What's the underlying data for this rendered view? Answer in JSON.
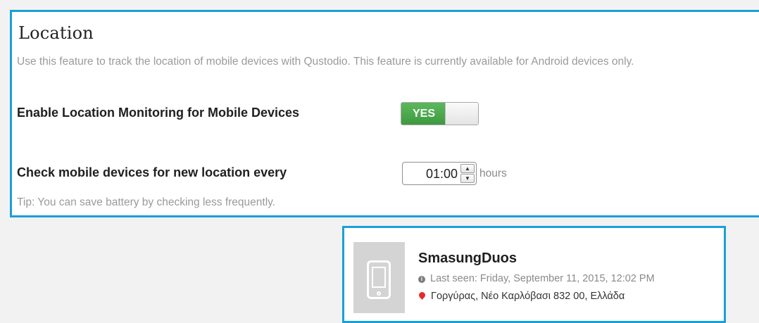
{
  "location": {
    "title": "Location",
    "description": "Use this feature to track the location of mobile devices with Qustodio. This feature is currently available for Android devices only.",
    "enable_label": "Enable Location Monitoring for Mobile Devices",
    "toggle_label": "YES",
    "toggle_on": true,
    "frequency_label": "Check mobile devices for new location every",
    "frequency_value": "01:00",
    "frequency_unit": "hours",
    "tip": "Tip: You can save battery by checking less frequently."
  },
  "device": {
    "name": "SmasungDuos",
    "last_seen": "Last seen: Friday, September 11, 2015, 12:02 PM",
    "address": "Γοργύρας, Νέο Καρλόβασι 832 00, Ελλάδα"
  },
  "icons": {
    "info": "info-icon",
    "pin": "map-pin-icon",
    "phone": "phone-icon",
    "stepper_up": "chevron-up-icon",
    "stepper_down": "chevron-down-icon"
  },
  "colors": {
    "highlight_border": "#1aa0d8",
    "toggle_on": "#4cae4c",
    "pin": "#e32b2b"
  }
}
